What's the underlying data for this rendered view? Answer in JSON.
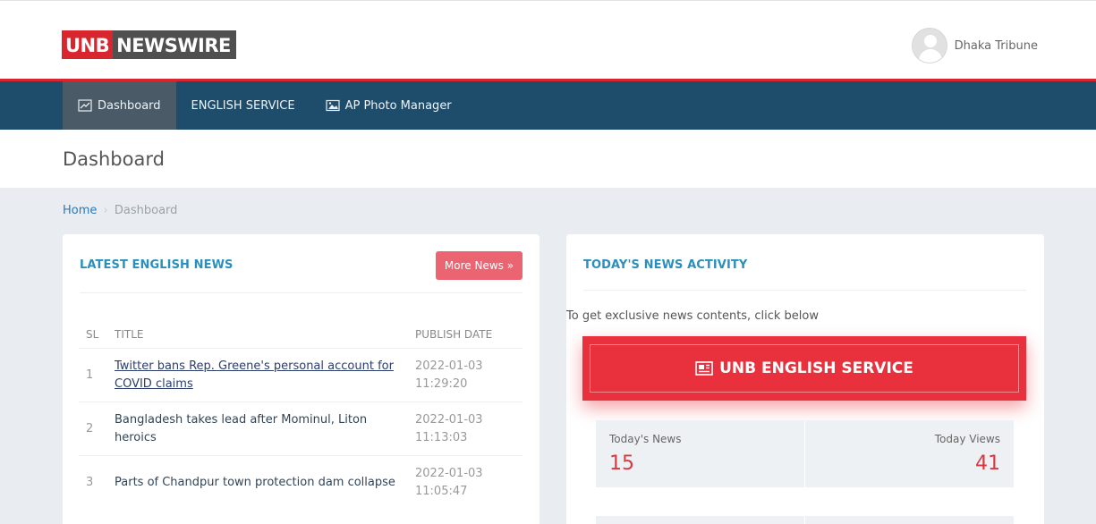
{
  "brand": {
    "logo_part1": "UNB",
    "logo_part2": "NEWSWIRE"
  },
  "user": {
    "name": "Dhaka Tribune"
  },
  "nav": {
    "items": [
      {
        "label": "Dashboard",
        "icon": "chart-line-icon",
        "active": true
      },
      {
        "label": "ENGLISH SERVICE",
        "icon": "",
        "active": false
      },
      {
        "label": "AP Photo Manager",
        "icon": "image-icon",
        "active": false
      }
    ]
  },
  "page": {
    "title": "Dashboard"
  },
  "breadcrumb": {
    "home": "Home",
    "current": "Dashboard"
  },
  "latest_news": {
    "title": "LATEST ENGLISH NEWS",
    "more_button": "More News »",
    "columns": {
      "sl": "SL",
      "title": "TITLE",
      "date": "PUBLISH DATE"
    },
    "rows": [
      {
        "sl": "1",
        "title": "Twitter bans Rep. Greene's personal account for COVID claims",
        "date": "2022-01-03",
        "time": "11:29:20"
      },
      {
        "sl": "2",
        "title": "Bangladesh takes lead after Mominul, Liton heroics",
        "date": "2022-01-03",
        "time": "11:13:03"
      },
      {
        "sl": "3",
        "title": "Parts of Chandpur  town protection dam collapse",
        "date": "2022-01-03",
        "time": "11:05:47"
      }
    ]
  },
  "activity": {
    "title": "TODAY'S NEWS ACTIVITY",
    "intro": "To get exclusive news contents, click below",
    "service_button": "UNB ENGLISH SERVICE",
    "todays_news_label": "Today's News",
    "todays_news_value": "15",
    "today_views_label": "Today Views",
    "today_views_value": "41"
  },
  "colors": {
    "brand_red": "#d9262e",
    "navbar": "#1e4d6b",
    "accent_blue": "#2a8fbd",
    "button_red": "#e8313d"
  }
}
